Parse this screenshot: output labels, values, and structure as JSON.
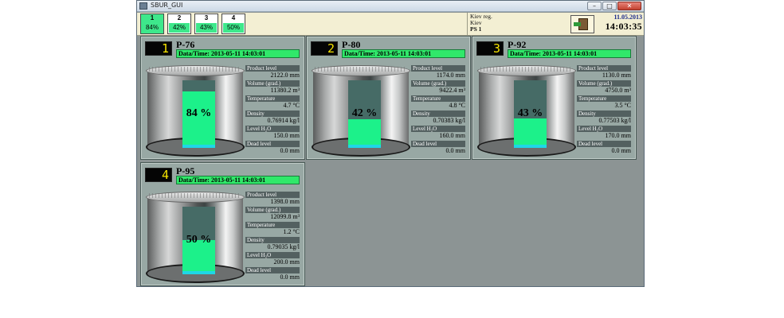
{
  "window": {
    "title": "SBUR_GUI",
    "min": "–",
    "max": "□",
    "close": "✕"
  },
  "toolbar": {
    "tabs": [
      {
        "num": "1",
        "pct": "84%"
      },
      {
        "num": "2",
        "pct": "42%"
      },
      {
        "num": "3",
        "pct": "43%"
      },
      {
        "num": "4",
        "pct": "50%"
      }
    ],
    "location": {
      "line1": "Kiev reg.",
      "line2": "Kiev",
      "line3": "PS 1"
    },
    "date": "11.05.2013",
    "time": "14:03:35",
    "exit_icon": "exit-door-icon"
  },
  "labels": {
    "product_level": "Product level",
    "volume": "Volume (grad.)",
    "temperature": "Temperature",
    "density": "Density",
    "level_h2o": "Level H₂O",
    "dead_level": "Dead level"
  },
  "tanks": [
    {
      "seg": "1",
      "name": "P-76",
      "datetime": "Data/Time: 2013-05-11 14:03:01",
      "percent": 84,
      "pct_label": "84 %",
      "product_level": "2122.0 mm",
      "volume": "11380.2 m³",
      "temperature": "4.7 °C",
      "density": "0.76914 kg/l",
      "level_h2o": "150.0 mm",
      "dead_level": "0.0 mm"
    },
    {
      "seg": "2",
      "name": "P-80",
      "datetime": "Data/Time: 2013-05-11 14:03:01",
      "percent": 42,
      "pct_label": "42 %",
      "product_level": "1174.0 mm",
      "volume": "9422.4 m³",
      "temperature": "4.8 °C",
      "density": "0.70383 kg/l",
      "level_h2o": "160.0 mm",
      "dead_level": "0.0 mm"
    },
    {
      "seg": "3",
      "name": "P-92",
      "datetime": "Data/Time: 2013-05-11 14:03:01",
      "percent": 43,
      "pct_label": "43 %",
      "product_level": "1130.0 mm",
      "volume": "4750.0 m³",
      "temperature": "3.5 °C",
      "density": "0.77503 kg/l",
      "level_h2o": "170.0 mm",
      "dead_level": "0.0 mm"
    },
    {
      "seg": "4",
      "name": "P-95",
      "datetime": "Data/Time: 2013-05-11 14:03:01",
      "percent": 50,
      "pct_label": "50 %",
      "product_level": "1398.0 mm",
      "volume": "12099.8 m³",
      "temperature": "1.2 °C",
      "density": "0.79035 kg/l",
      "level_h2o": "200.0 mm",
      "dead_level": "0.0 mm"
    }
  ],
  "colors": {
    "fill": "#1cf18a",
    "water": "#1fd6e6",
    "datetime_bg": "#30e86a",
    "digit": "#f6e400"
  }
}
